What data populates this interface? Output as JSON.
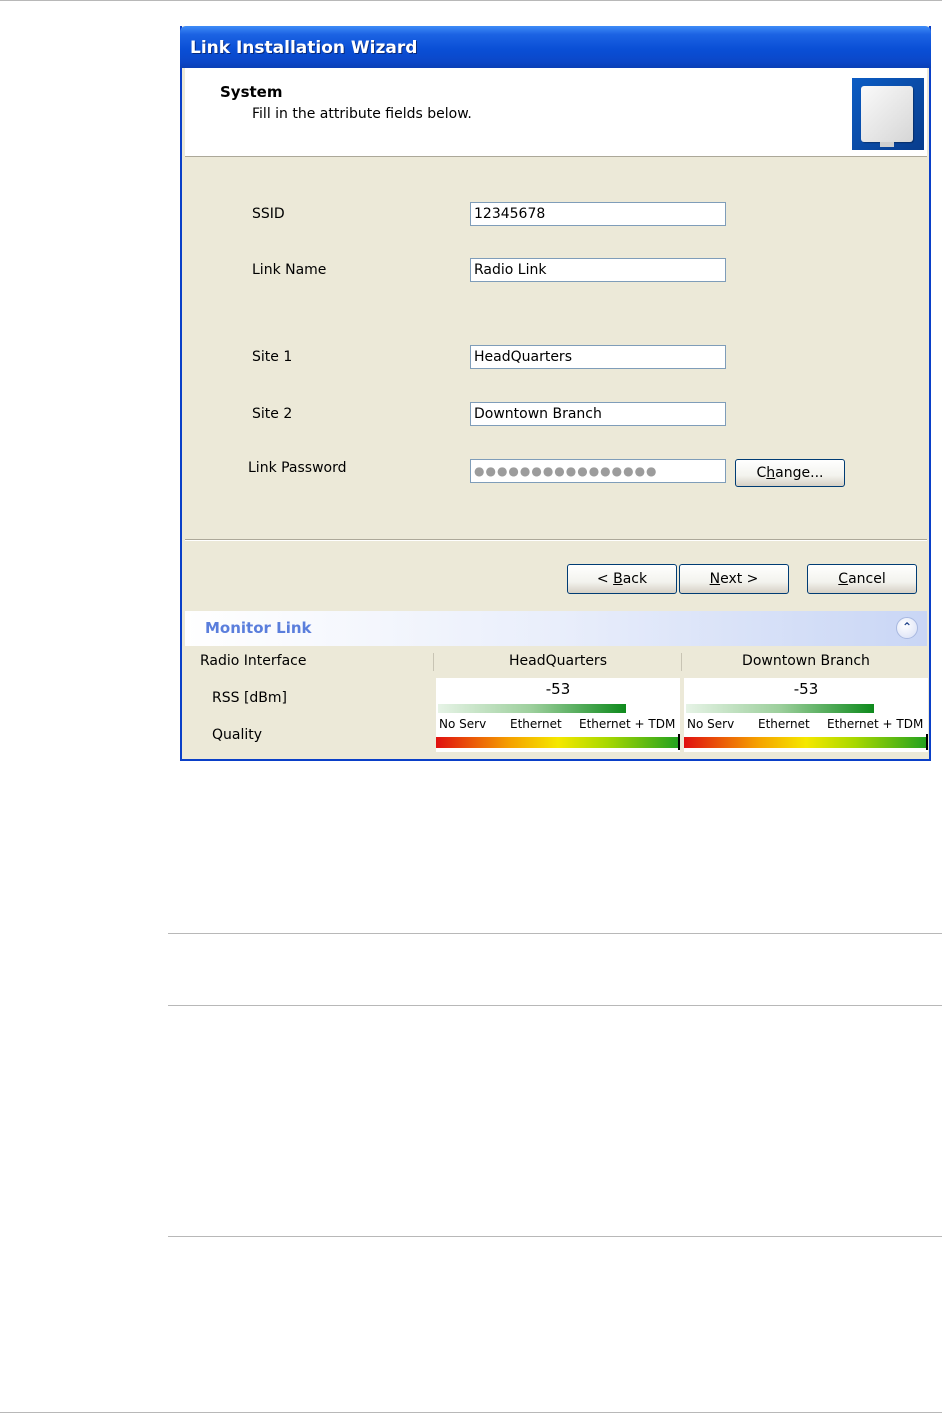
{
  "window": {
    "title": "Link Installation Wizard"
  },
  "header": {
    "title": "System",
    "subtitle": "Fill in the attribute fields below."
  },
  "form": {
    "ssid": {
      "label": "SSID",
      "value": "12345678"
    },
    "link_name": {
      "label": "Link Name",
      "value": "Radio Link"
    },
    "site1": {
      "label": "Site 1",
      "value": "HeadQuarters"
    },
    "site2": {
      "label": "Site 2",
      "value": "Downtown Branch"
    },
    "password": {
      "label": "Link Password",
      "value": "●●●●●●●●●●●●●●●●",
      "change_prefix": "C",
      "change_accel": "h",
      "change_rest": "ange..."
    }
  },
  "buttons": {
    "back": {
      "prefix": "< ",
      "accel": "B",
      "rest": "ack"
    },
    "next": {
      "prefix": "",
      "accel": "N",
      "rest": "ext >"
    },
    "cancel": {
      "prefix": "",
      "accel": "C",
      "rest": "ancel"
    }
  },
  "monitor": {
    "title": "Monitor Link",
    "collapse_icon": "double-chevron-up-icon",
    "columns": [
      "Radio Interface",
      "HeadQuarters",
      "Downtown Branch"
    ],
    "rows": {
      "rss_label": "RSS [dBm]",
      "quality_label": "Quality"
    },
    "sites": [
      {
        "rss": "-53",
        "rss_fraction": 0.77
      },
      {
        "rss": "-53",
        "rss_fraction": 0.77
      }
    ],
    "quality_scale": [
      "No Serv",
      "Ethernet",
      "Ethernet + TDM"
    ]
  }
}
